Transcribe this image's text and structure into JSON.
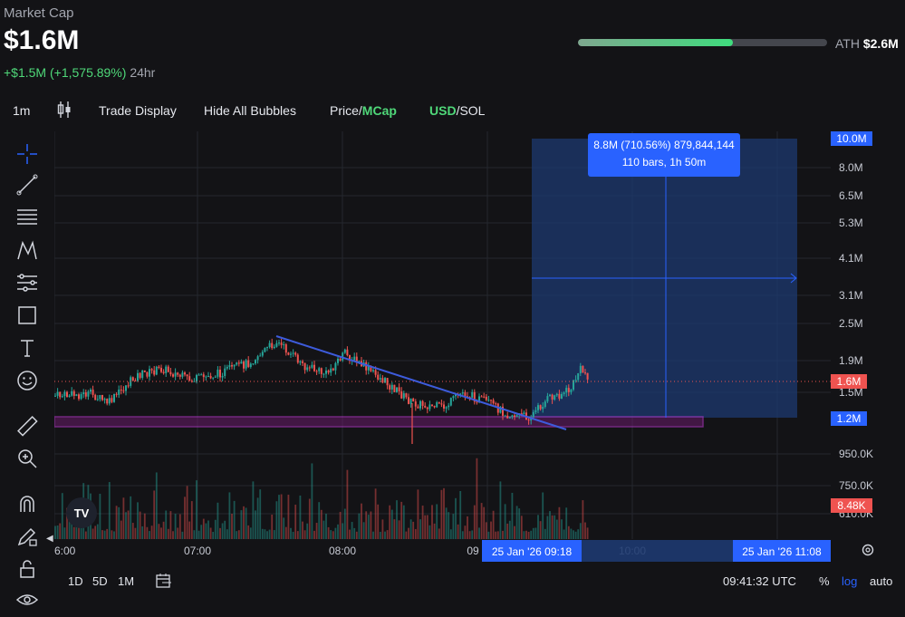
{
  "header": {
    "label": "Market Cap",
    "value": "$1.6M",
    "change_abs": "+$1.5M",
    "change_pct": "(+1,575.89%)",
    "period": "24hr",
    "ath_label": "ATH",
    "ath_value": "$2.6M",
    "ath_progress": 0.62
  },
  "toolbar": {
    "interval": "1m",
    "trade_display": "Trade Display",
    "hide_bubbles": "Hide All Bubbles",
    "price_label": "Price/",
    "mcap_label": "MCap",
    "usd_label": "USD",
    "sol_label": "/SOL"
  },
  "tools": [
    "crosshair-icon",
    "trendline-icon",
    "fib-icon",
    "pattern-icon",
    "measure-icon",
    "rectangle-icon",
    "text-icon",
    "emoji-icon",
    "ruler-icon",
    "zoom-in-icon",
    "magnet-icon",
    "pencil-lock-icon",
    "lock-icon",
    "eye-icon"
  ],
  "chart": {
    "y_ticks": [
      "8.0M",
      "6.5M",
      "5.3M",
      "4.1M",
      "3.1M",
      "2.5M",
      "1.9M",
      "1.5M",
      "950.0K",
      "750.0K",
      "610.0K"
    ],
    "x_ticks": [
      "6:00",
      "07:00",
      "08:00",
      "09",
      "10:00"
    ],
    "badge_top": "10.0M",
    "badge_current": "1.6M",
    "badge_bottom": "1.2M",
    "badge_volume": "8.48K",
    "measure_line1": "8.8M (710.56%) 879,844,144",
    "measure_line2": "110 bars, 1h 50m",
    "x_badge_left": "25 Jan '26   09:18",
    "x_badge_right": "25 Jan '26   11:08",
    "logo": "TV"
  },
  "bottom": {
    "ranges": [
      "1D",
      "5D",
      "1M"
    ],
    "time": "09:41:32 UTC",
    "percent": "%",
    "log": "log",
    "auto": "auto"
  },
  "colors": {
    "up": "#26a69a",
    "down": "#ef5350",
    "accent": "#2962ff",
    "mcap": "#4fd879",
    "zone": "#9c27b0"
  }
}
